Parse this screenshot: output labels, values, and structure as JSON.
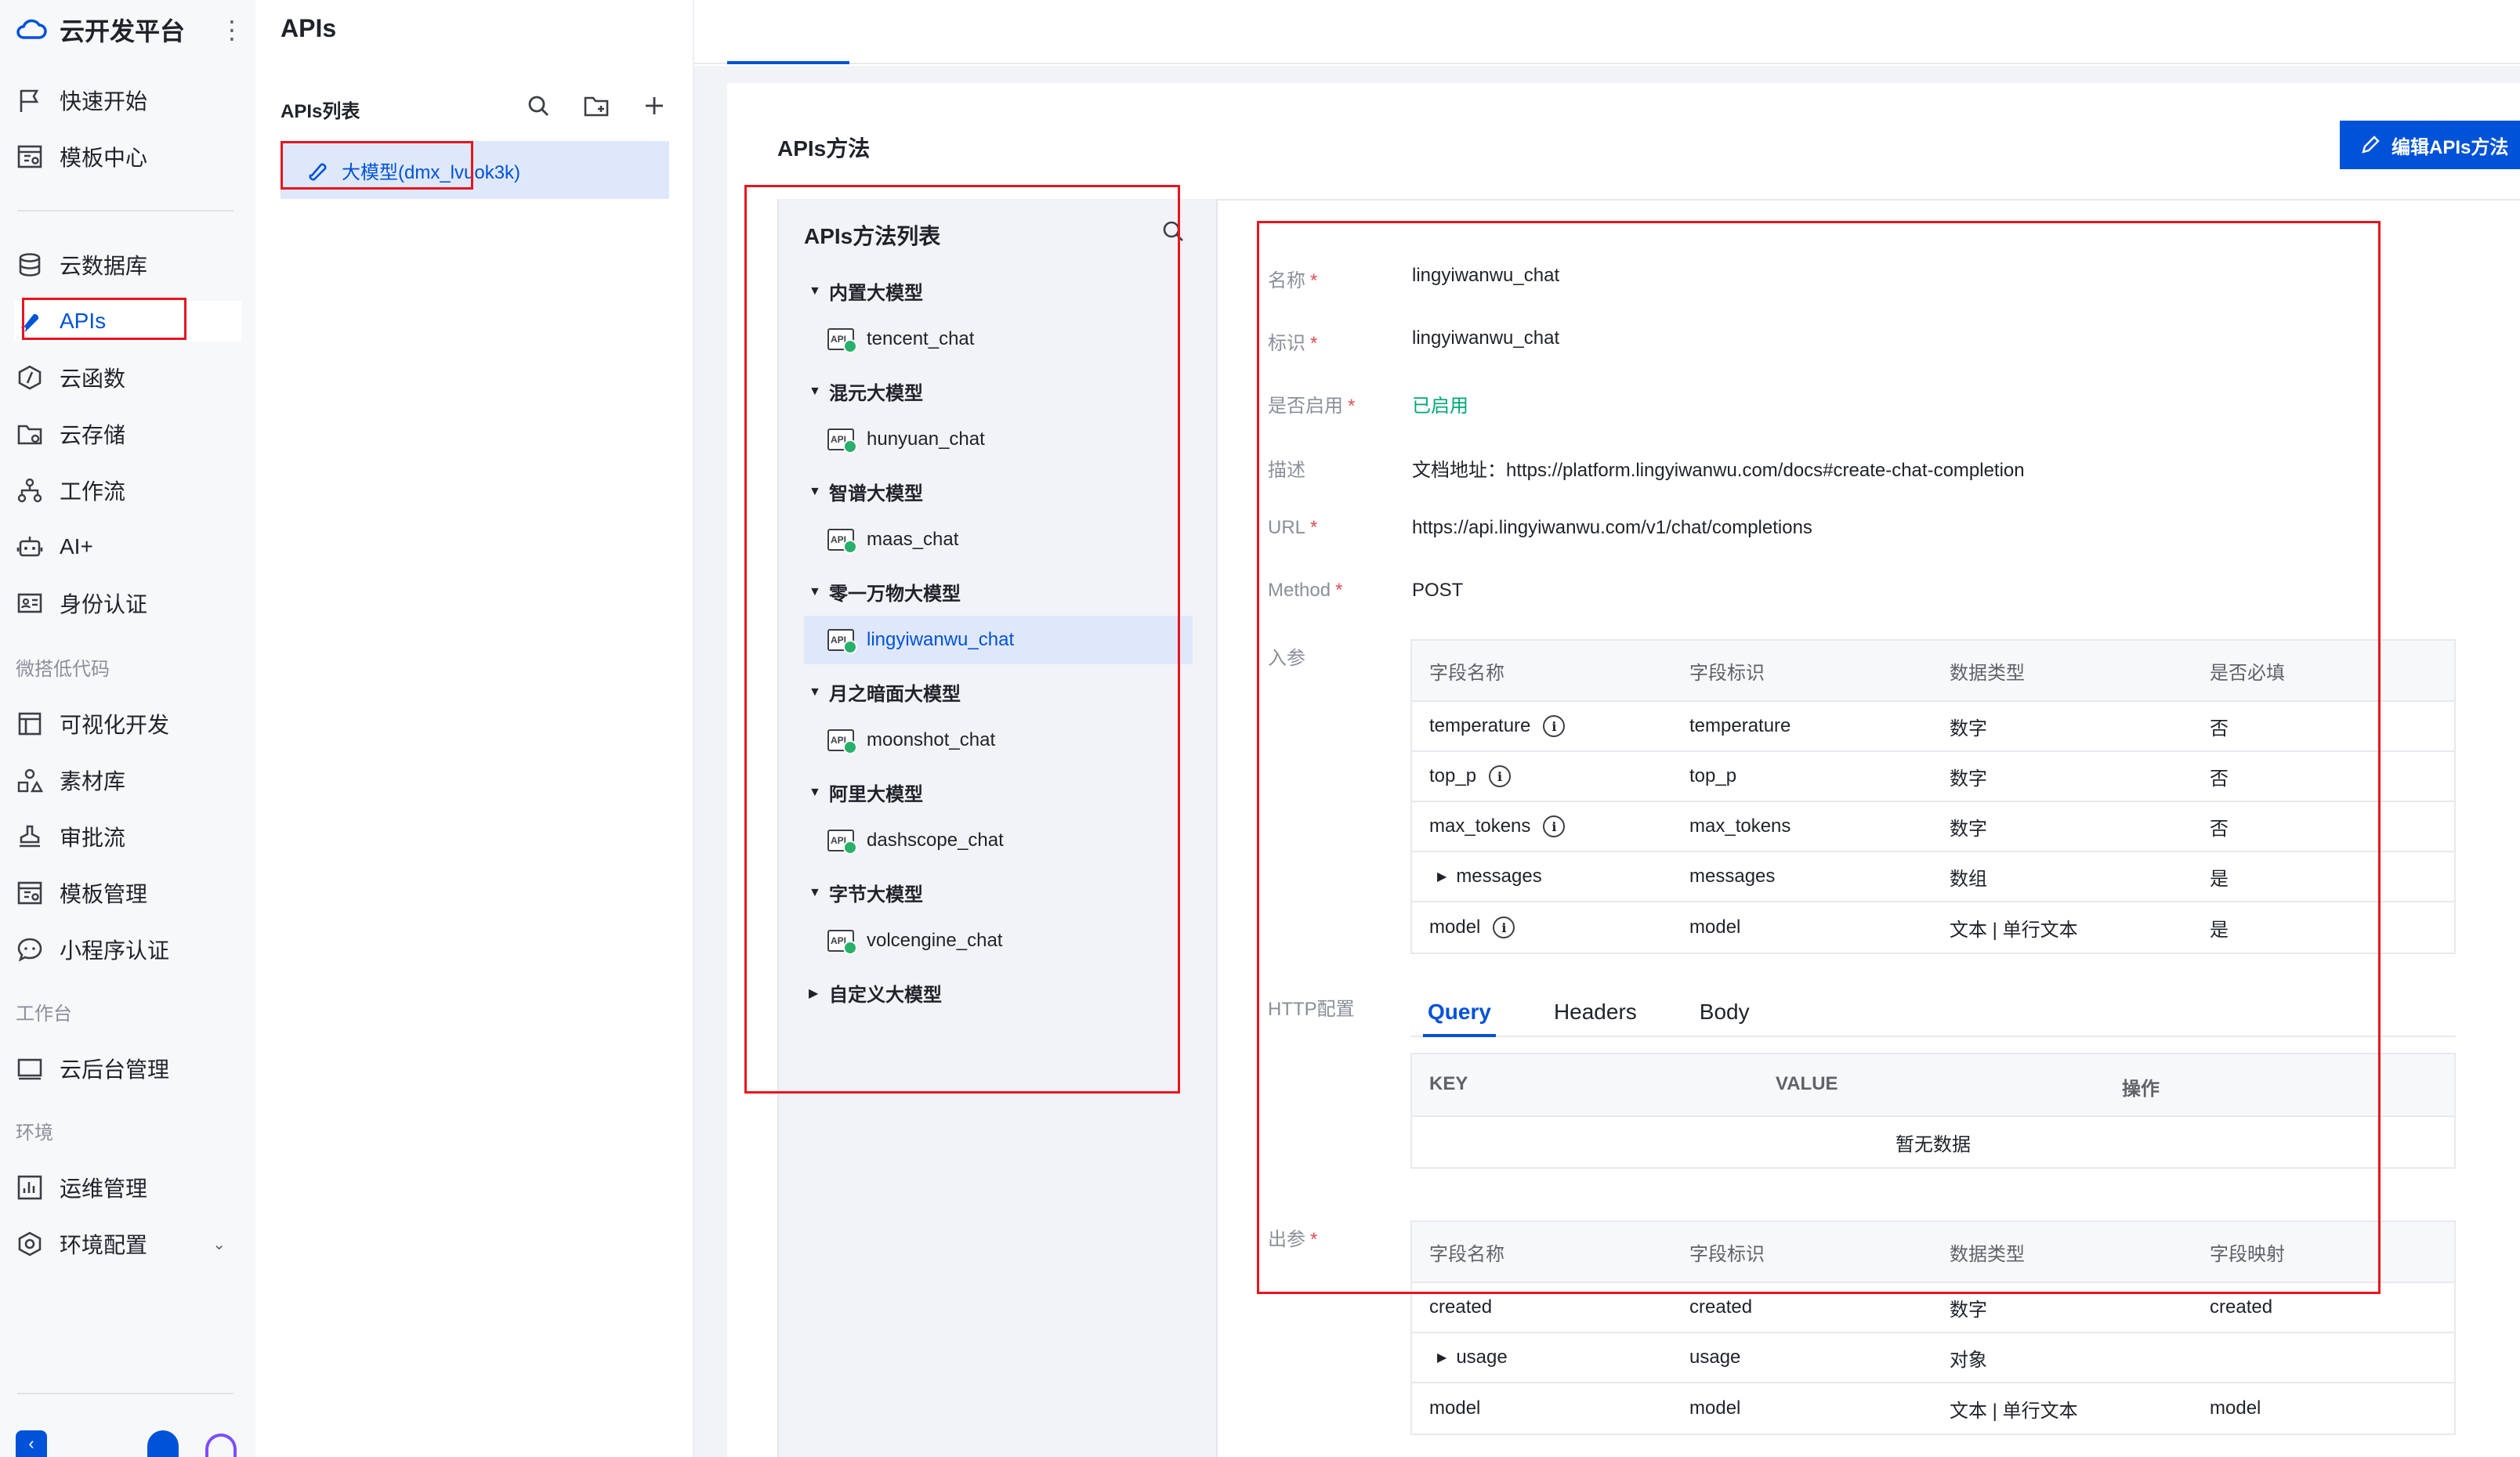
{
  "app": {
    "name": "云开发平台",
    "page_title": "APIs"
  },
  "sidebar": {
    "items_a": [
      {
        "label": "快速开始",
        "icon": "flag-icon"
      },
      {
        "label": "模板中心",
        "icon": "template-icon"
      }
    ],
    "items_b": [
      {
        "label": "云数据库",
        "icon": "database-icon"
      },
      {
        "label": "APIs",
        "icon": "api-icon"
      },
      {
        "label": "云函数",
        "icon": "function-icon"
      },
      {
        "label": "云存储",
        "icon": "folder-icon"
      },
      {
        "label": "工作流",
        "icon": "workflow-icon"
      },
      {
        "label": "AI+",
        "icon": "robot-icon"
      },
      {
        "label": "身份认证",
        "icon": "id-card-icon"
      }
    ],
    "section_lowcode": "微搭低代码",
    "items_c": [
      {
        "label": "可视化开发",
        "icon": "layout-icon"
      },
      {
        "label": "素材库",
        "icon": "shapes-icon"
      },
      {
        "label": "审批流",
        "icon": "stamp-icon"
      },
      {
        "label": "模板管理",
        "icon": "template-icon"
      },
      {
        "label": "小程序认证",
        "icon": "chat-icon"
      }
    ],
    "section_workbench": "工作台",
    "items_d": [
      {
        "label": "云后台管理",
        "icon": "monitor-icon"
      }
    ],
    "section_env": "环境",
    "items_e": [
      {
        "label": "运维管理",
        "icon": "chart-icon"
      },
      {
        "label": "环境配置",
        "icon": "settings-icon"
      }
    ]
  },
  "apis_list": {
    "title": "APIs列表",
    "item": "大模型(dmx_lvuok3k)"
  },
  "methods": {
    "card_title": "APIs方法",
    "edit_button": "编辑APIs方法",
    "list_title": "APIs方法列表",
    "groups": [
      {
        "name": "内置大模型",
        "expanded": true,
        "child": "tencent_chat"
      },
      {
        "name": "混元大模型",
        "expanded": true,
        "child": "hunyuan_chat"
      },
      {
        "name": "智谱大模型",
        "expanded": true,
        "child": "maas_chat"
      },
      {
        "name": "零一万物大模型",
        "expanded": true,
        "child": "lingyiwanwu_chat"
      },
      {
        "name": "月之暗面大模型",
        "expanded": true,
        "child": "moonshot_chat"
      },
      {
        "name": "阿里大模型",
        "expanded": true,
        "child": "dashscope_chat"
      },
      {
        "name": "字节大模型",
        "expanded": true,
        "child": "volcengine_chat"
      },
      {
        "name": "自定义大模型",
        "expanded": false,
        "child": ""
      }
    ],
    "selected": "lingyiwanwu_chat"
  },
  "detail": {
    "name_label": "名称",
    "name_value": "lingyiwanwu_chat",
    "id_label": "标识",
    "id_value": "lingyiwanwu_chat",
    "enabled_label": "是否启用",
    "enabled_value": "已启用",
    "desc_label": "描述",
    "desc_value": "文档地址：https://platform.lingyiwanwu.com/docs#create-chat-completion",
    "url_label": "URL",
    "url_value": "https://api.lingyiwanwu.com/v1/chat/completions",
    "method_label": "Method",
    "method_value": "POST",
    "input_label": "入参",
    "input_headers": [
      "字段名称",
      "字段标识",
      "数据类型",
      "是否必填"
    ],
    "input_rows": [
      [
        "temperature",
        "temperature",
        "数字",
        "否"
      ],
      [
        "top_p",
        "top_p",
        "数字",
        "否"
      ],
      [
        "max_tokens",
        "max_tokens",
        "数字",
        "否"
      ],
      [
        "messages",
        "messages",
        "数组",
        "是"
      ],
      [
        "model",
        "model",
        "文本 | 单行文本",
        "是"
      ]
    ],
    "http_label": "HTTP配置",
    "http_tabs": [
      "Query",
      "Headers",
      "Body"
    ],
    "kv_headers": [
      "KEY",
      "VALUE",
      "操作"
    ],
    "kv_empty": "暂无数据",
    "output_label": "出参",
    "output_headers": [
      "字段名称",
      "字段标识",
      "数据类型",
      "字段映射"
    ],
    "output_rows": [
      [
        "created",
        "created",
        "数字",
        "created"
      ],
      [
        "usage",
        "usage",
        "对象",
        ""
      ],
      [
        "model",
        "model",
        "文本 | 单行文本",
        "model"
      ]
    ]
  },
  "colors": {
    "accent": "#0052d9",
    "enabled": "#00a870",
    "annotation": "#e8141f"
  }
}
